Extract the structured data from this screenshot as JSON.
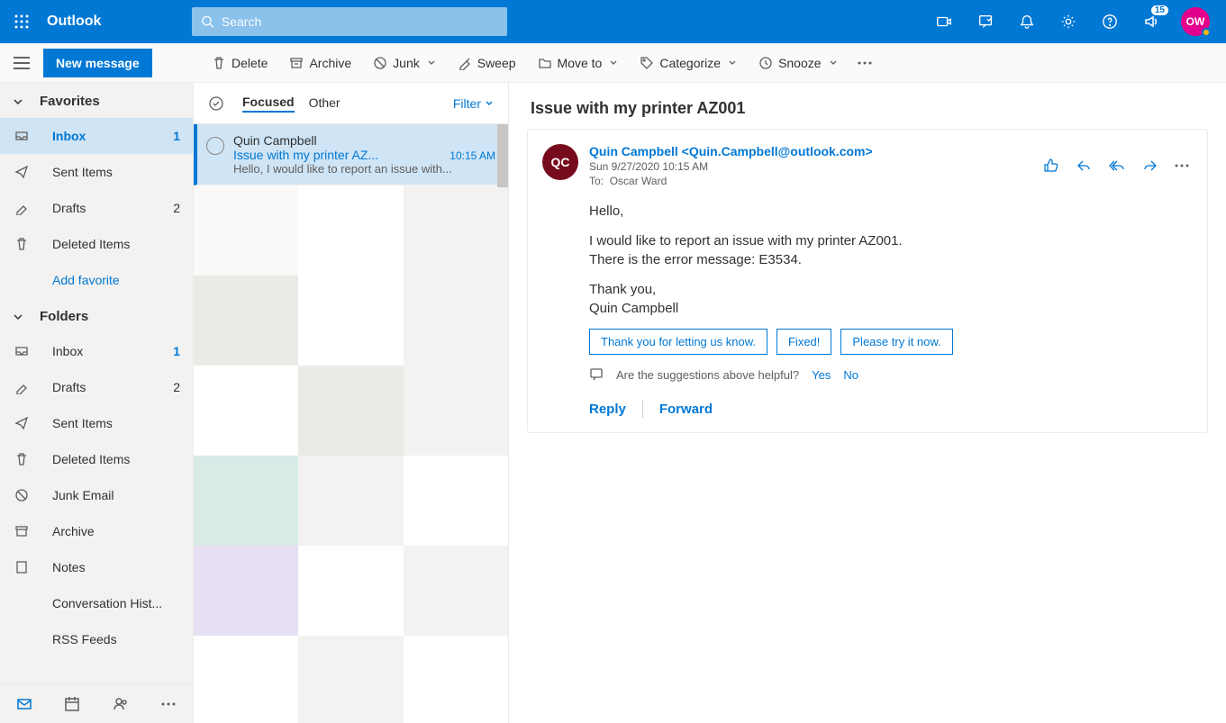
{
  "app": {
    "name": "Outlook",
    "search_placeholder": "Search",
    "notif_count": "15",
    "avatar_initials": "OW"
  },
  "commands": {
    "new_message": "New message",
    "delete": "Delete",
    "archive": "Archive",
    "junk": "Junk",
    "sweep": "Sweep",
    "moveto": "Move to",
    "categorize": "Categorize",
    "snooze": "Snooze"
  },
  "nav": {
    "favorites": "Favorites",
    "folders": "Folders",
    "fav_items": [
      {
        "label": "Inbox",
        "count": "1"
      },
      {
        "label": "Sent Items",
        "count": ""
      },
      {
        "label": "Drafts",
        "count": "2"
      },
      {
        "label": "Deleted Items",
        "count": ""
      }
    ],
    "add_favorite": "Add favorite",
    "folder_items": [
      {
        "label": "Inbox",
        "count": "1"
      },
      {
        "label": "Drafts",
        "count": "2"
      },
      {
        "label": "Sent Items",
        "count": ""
      },
      {
        "label": "Deleted Items",
        "count": ""
      },
      {
        "label": "Junk Email",
        "count": ""
      },
      {
        "label": "Archive",
        "count": ""
      },
      {
        "label": "Notes",
        "count": ""
      },
      {
        "label": "Conversation Hist...",
        "count": ""
      },
      {
        "label": "RSS Feeds",
        "count": ""
      }
    ]
  },
  "list": {
    "tab_focused": "Focused",
    "tab_other": "Other",
    "filter": "Filter",
    "items": [
      {
        "from": "Quin Campbell",
        "subject": "Issue with my printer AZ...",
        "time": "10:15 AM",
        "preview": "Hello, I would like to report an issue with..."
      }
    ]
  },
  "reading": {
    "subject": "Issue with my printer AZ001",
    "avatar": "QC",
    "sender_display": "Quin Campbell <Quin.Campbell@outlook.com>",
    "date": "Sun 9/27/2020 10:15 AM",
    "to_label": "To:",
    "to_value": "Oscar Ward",
    "body_p1": "Hello,",
    "body_p2a": "I would like to report an issue with my printer AZ001.",
    "body_p2b": "There is the error message: E3534.",
    "body_p3a": "Thank you,",
    "body_p3b": "Quin Campbell",
    "suggestions": [
      "Thank you for letting us know.",
      "Fixed!",
      "Please try it now."
    ],
    "feedback_q": "Are the suggestions above helpful?",
    "yes": "Yes",
    "no": "No",
    "reply": "Reply",
    "forward": "Forward"
  }
}
